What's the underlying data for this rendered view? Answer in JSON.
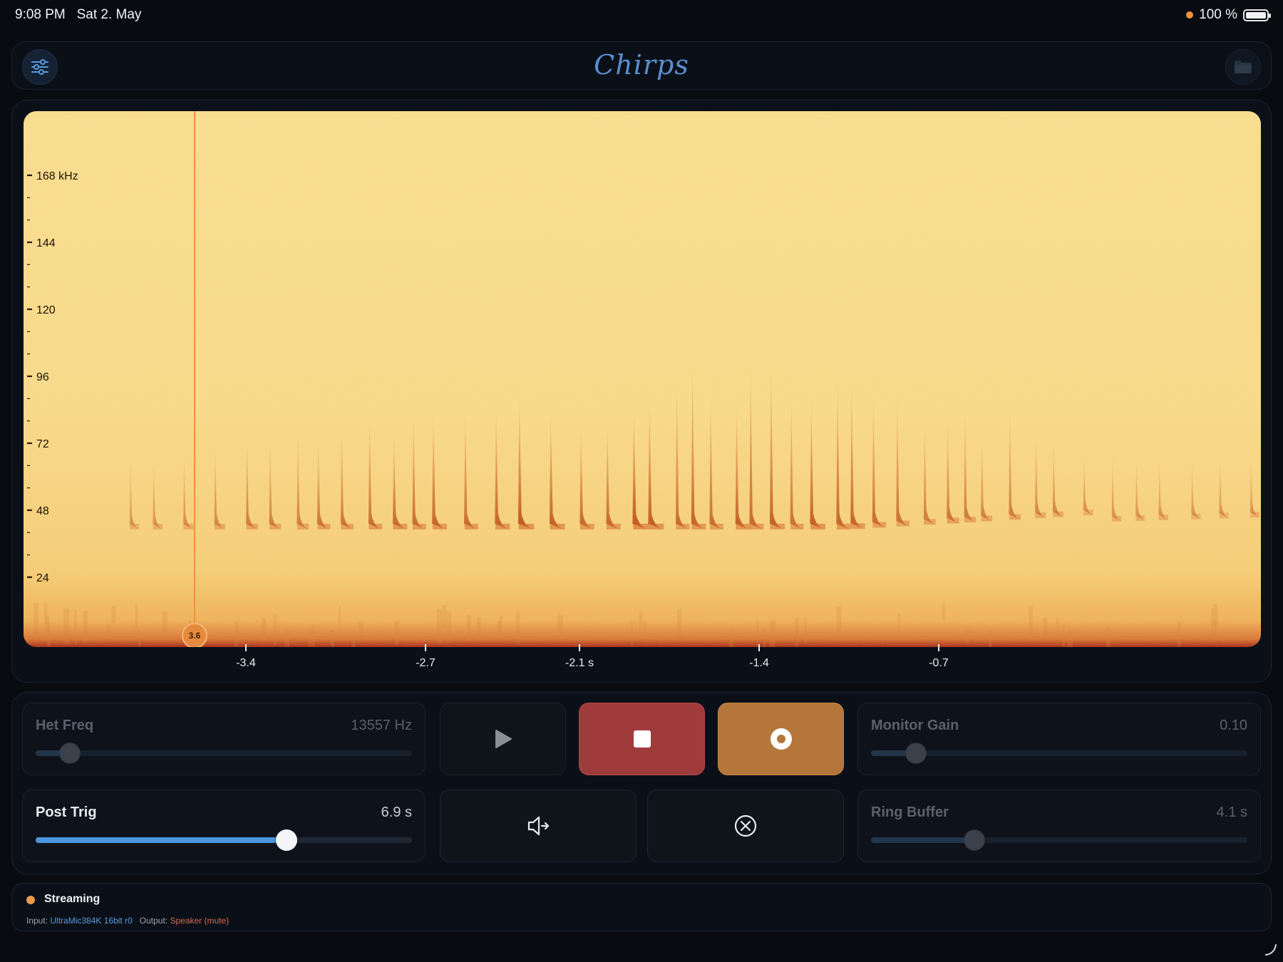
{
  "status_bar": {
    "time": "9:08 PM",
    "date": "Sat 2. May",
    "battery_percent": "100 %",
    "recording_dot_color": "#f0913a"
  },
  "header": {
    "title": "Chirps",
    "left_icon": "sliders-icon",
    "right_icon": "folder-icon"
  },
  "spectrogram": {
    "freq_labels": [
      {
        "label": "168 kHz",
        "value": 168
      },
      {
        "label": "144",
        "value": 144
      },
      {
        "label": "120",
        "value": 120
      },
      {
        "label": "96",
        "value": 96
      },
      {
        "label": "72",
        "value": 72
      },
      {
        "label": "48",
        "value": 48
      },
      {
        "label": "24",
        "value": 24
      }
    ],
    "time_labels": [
      {
        "label": "-3.4",
        "value": -3.4
      },
      {
        "label": "-2.7",
        "value": -2.7
      },
      {
        "label": "-2.1 s",
        "value": -2.1
      },
      {
        "label": "-1.4",
        "value": -1.4
      },
      {
        "label": "-0.7",
        "value": -0.7
      }
    ],
    "trigger_marker": {
      "label": "3.6",
      "value": -3.6
    },
    "colors": {
      "background": "#f7d98a",
      "call": "#c0561b",
      "marker": "#f0913a"
    }
  },
  "controls": {
    "het_freq": {
      "label": "Het Freq",
      "value": "13557 Hz",
      "level": 0.09,
      "enabled": false
    },
    "monitor_gain": {
      "label": "Monitor Gain",
      "value": "0.10",
      "level": 0.12,
      "enabled": false
    },
    "post_trig": {
      "label": "Post Trig",
      "value": "6.9 s",
      "level": 0.667,
      "enabled": true
    },
    "ring_buffer": {
      "label": "Ring Buffer",
      "value": "4.1 s",
      "level": 0.275,
      "enabled": false
    },
    "play_icon": "play-icon",
    "stop_icon": "stop-icon",
    "record_icon": "record-icon",
    "mute_icon": "speaker-mute-icon",
    "cancel_icon": "cancel-circle-icon",
    "stop_color": "#a03b3c",
    "record_color": "#b4763a",
    "accent": "#4a97e0"
  },
  "footer": {
    "status": "Streaming",
    "status_color": "#eb9a4a",
    "input_label": "Input:",
    "input_device": "UltraMic384K 16bit r0",
    "output_label": "Output:",
    "output_device": "Speaker (mute)"
  }
}
